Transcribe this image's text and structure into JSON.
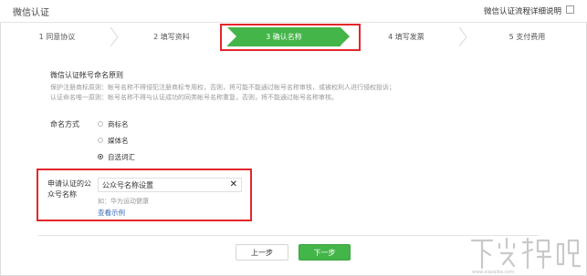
{
  "header": {
    "title": "微信认证",
    "help_label": "微信认证流程详细说明"
  },
  "steps": [
    {
      "label": "1 同意协议",
      "active": false
    },
    {
      "label": "2 填写资料",
      "active": false
    },
    {
      "label": "3 确认名称",
      "active": true
    },
    {
      "label": "4 填写发票",
      "active": false
    },
    {
      "label": "5 支付费用",
      "active": false
    }
  ],
  "info": {
    "title": "微信认证帐号命名原则",
    "lines": [
      "保护注册商标原则：帐号名称不得侵犯注册商标专用权，否则，将可能不能通过帐号名称审核，或被权利人进行侵权投诉；",
      "认证命名唯一原则：帐号名称不得与认证成功的同类帐号名称重复，否则，将不能通过帐号名称审核。"
    ]
  },
  "naming": {
    "label": "命名方式",
    "options": [
      {
        "label": "商标名",
        "checked": false
      },
      {
        "label": "媒体名",
        "checked": false
      },
      {
        "label": "自选词汇",
        "checked": true
      }
    ]
  },
  "account_name": {
    "label": "申请认证的公众号名称",
    "value": "公众号名称设置",
    "example": "如：华为运动健康",
    "example_link": "查看示例"
  },
  "buttons": {
    "prev": "上一步",
    "next": "下一步"
  },
  "colors": {
    "accent": "#44b549",
    "highlight": "#e3262b",
    "link": "#3b6cb4"
  },
  "watermark": {
    "text": "下载吧"
  }
}
